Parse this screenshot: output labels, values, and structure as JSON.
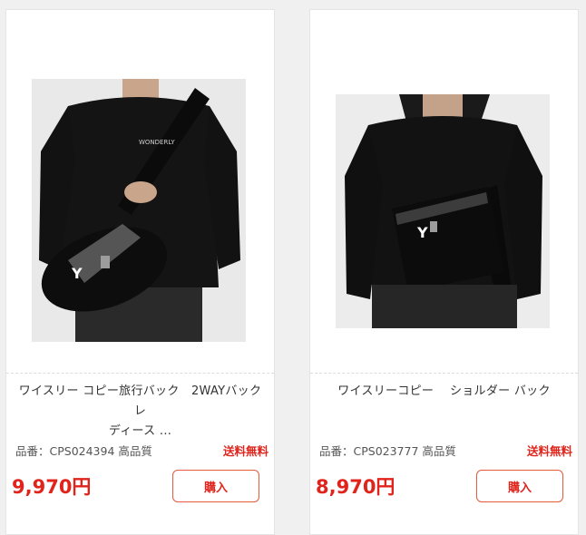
{
  "products": [
    {
      "title_line1": "ワイスリー コピー旅行バック　2WAYバック レ",
      "title_line2": "ディース ...",
      "code": "品番：CPS024394 高品質",
      "shipping": "送料無料",
      "price": "9,970円",
      "buy_label": "購入",
      "shirt_text": "WONDERLY"
    },
    {
      "title_line1": "ワイスリーコピー　 ショルダー バック",
      "title_line2": "",
      "code": "品番：CPS023777 高品質",
      "shipping": "送料無料",
      "price": "8,970円",
      "buy_label": "購入"
    }
  ],
  "colors": {
    "accent_red": "#e0241c",
    "card_bg": "#ffffff",
    "page_bg": "#f0f0f0"
  }
}
